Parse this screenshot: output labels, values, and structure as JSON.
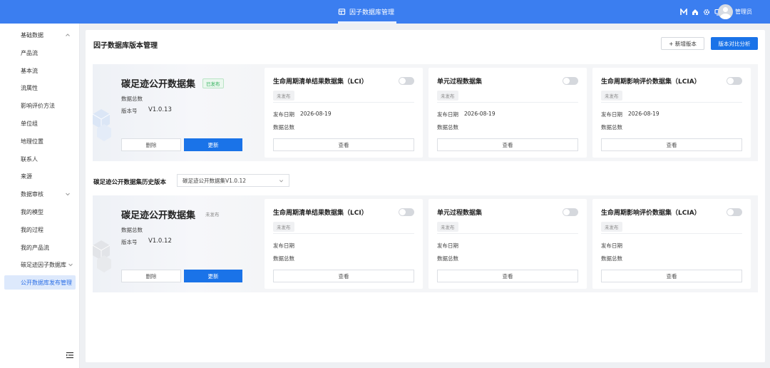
{
  "app": {
    "title": "因子数据库管理",
    "user": "管理员"
  },
  "sidebar": {
    "items": [
      {
        "label": "基础数据",
        "expanded": true
      },
      {
        "label": "产品流"
      },
      {
        "label": "基本流"
      },
      {
        "label": "流属性"
      },
      {
        "label": "影响评价方法"
      },
      {
        "label": "单位组"
      },
      {
        "label": "地理位置"
      },
      {
        "label": "联系人"
      },
      {
        "label": "来源"
      },
      {
        "label": "数据审核",
        "expanded": false
      },
      {
        "label": "我的模型"
      },
      {
        "label": "我的过程"
      },
      {
        "label": "我的产品流"
      },
      {
        "label": "碳足迹因子数据库",
        "expanded": false
      },
      {
        "label": "公开数据库发布管理",
        "active": true
      }
    ]
  },
  "page": {
    "title": "因子数据库版本管理",
    "new_version_label": "+ 新增版本",
    "compare_label": "版本对比分析"
  },
  "history": {
    "label": "碳足迹公开数据集历史版本",
    "selected": "碳足迹公开数据集V1.0.12"
  },
  "current": {
    "title": "碳足迹公开数据集",
    "status": "已发布",
    "count_label": "数据总数",
    "version_label": "版本号",
    "version": "V1.0.13",
    "delete_label": "删除",
    "update_label": "更新",
    "cards": [
      {
        "title": "生命周期清单结果数据集（LCI）",
        "tag": "未发布",
        "date_label": "发布日期",
        "date": "2026-08-19",
        "count_label": "数据总数",
        "view_label": "查看",
        "enabled": false
      },
      {
        "title": "单元过程数据集",
        "tag": "未发布",
        "date_label": "发布日期",
        "date": "2026-08-19",
        "count_label": "数据总数",
        "view_label": "查看",
        "enabled": false
      },
      {
        "title": "生命周期影响评价数据集（LCIA）",
        "tag": "未发布",
        "date_label": "发布日期",
        "date": "2026-08-19",
        "count_label": "数据总数",
        "view_label": "查看",
        "enabled": false
      }
    ]
  },
  "previous": {
    "title": "碳足迹公开数据集",
    "status": "未发布",
    "count_label": "数据总数",
    "version_label": "版本号",
    "version": "V1.0.12",
    "delete_label": "删除",
    "update_label": "更新",
    "cards": [
      {
        "title": "生命周期清单结果数据集（LCI）",
        "tag": "未发布",
        "date_label": "发布日期",
        "date": "",
        "count_label": "数据总数",
        "view_label": "查看",
        "enabled": false
      },
      {
        "title": "单元过程数据集",
        "tag": "未发布",
        "date_label": "发布日期",
        "date": "",
        "count_label": "数据总数",
        "view_label": "查看",
        "enabled": false
      },
      {
        "title": "生命周期影响评价数据集（LCIA）",
        "tag": "未发布",
        "date_label": "发布日期",
        "date": "",
        "count_label": "数据总数",
        "view_label": "查看",
        "enabled": false
      }
    ]
  },
  "colors": {
    "primary": "#1a73e8",
    "topbar": "#3b7ef0",
    "published": "#2fb05b"
  },
  "icons": [
    "database-icon",
    "m-logo-icon",
    "home-icon",
    "gear-icon",
    "monitor-icon",
    "bell-icon",
    "menu-collapse-icon",
    "chevron-down-icon",
    "chevron-up-icon"
  ]
}
